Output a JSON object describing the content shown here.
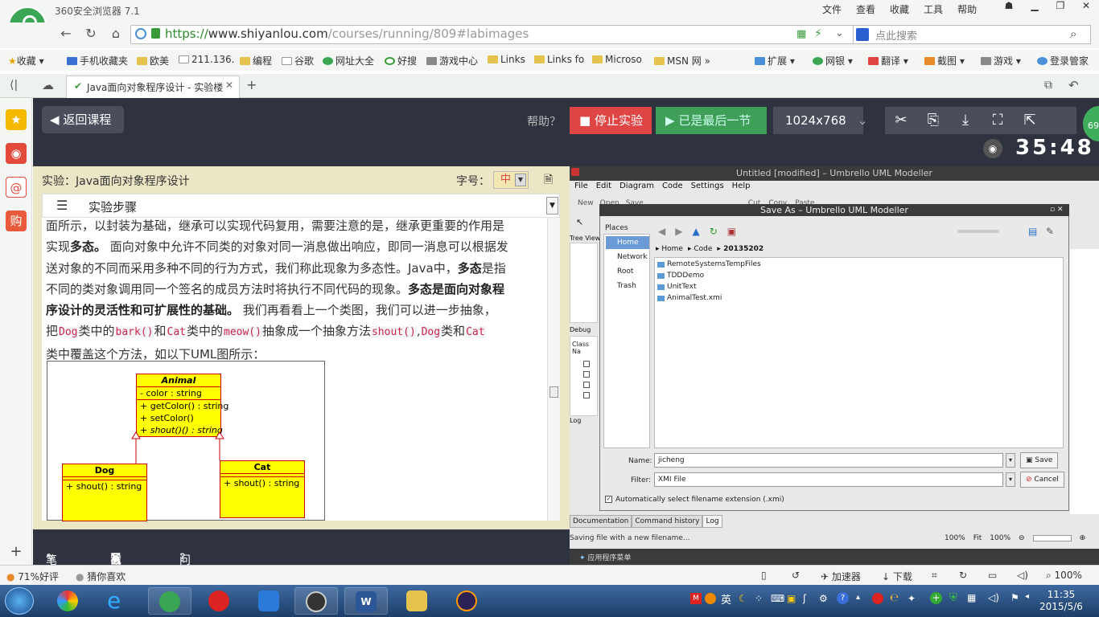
{
  "browser": {
    "app_title": "360安全浏览器 7.1",
    "menu": [
      "文件",
      "查看",
      "收藏",
      "工具",
      "帮助"
    ],
    "url_scheme": "https://",
    "url_host": "www.shiyanlou.com",
    "url_path": "/courses/running/809#labimages",
    "search_placeholder": "点此搜索",
    "bookmarks": [
      "收藏",
      "手机收藏夹",
      "欧美",
      "211.136.",
      "编程",
      "谷歌",
      "网址大全",
      "好搜",
      "游戏中心",
      "Links",
      "Links fo",
      "Microso",
      "MSN 网"
    ],
    "extensions": [
      "扩展",
      "网银",
      "翻译",
      "截图",
      "游戏",
      "登录管家"
    ],
    "tab_title": "Java面向对象程序设计 - 实验楼"
  },
  "lab": {
    "back_label": "返回课程",
    "help_label": "帮助？",
    "stop_label": "停止实验",
    "last_label": "已是最后一节",
    "resolution": "1024x768",
    "timer": "35:48",
    "badge": "69",
    "doc_title": "实验：Java面向对象程序设计",
    "font_label": "字号：",
    "font_value": "中",
    "steps_label": "实验步骤",
    "para": {
      "l1": "面所示，以封装为基础，继承可以实现代码复用，需要注意的是，继承更重要的作用是",
      "l2a": "实现",
      "l2b": "多态。",
      "l2c": " 面向对象中允许不同类的对象对同一消息做出响应，即同一消息可以根据发",
      "l3": "送对象的不同而采用多种不同的行为方式，我们称此现象为多态性。Java中，",
      "l3b": "多态",
      "l3c": "是指",
      "l4a": "不同的类对象调用同一个签名的成员方法时将执行不同代码的现象。",
      "l4b": "多态是面向对象程",
      "l5a": "序设计的灵活性和可扩展性的基础。",
      "l5b": " 我们再看看上一个类图，我们可以进一步抽象，",
      "l6a": "把",
      "c_dog": "Dog",
      "l6b": "类中的",
      "c_bark": "bark()",
      "l6c": "和",
      "c_cat": "Cat",
      "l6d": "类中的",
      "c_meow": "meow()",
      "l6e": "抽象成一个抽象方法",
      "c_shout": "shout()",
      "l6f": ",",
      "c_dog2": "Dog",
      "l6g": "类和",
      "c_cat2": "Cat",
      "l7": "类中覆盖这个方法，如以下UML图所示："
    },
    "uml": {
      "animal_name": "Animal",
      "animal_attr": "- color : string",
      "animal_ops": [
        "+ getColor() : string",
        "+ setColor()",
        "+ shout()() : string"
      ],
      "dog_name": "Dog",
      "dog_op": "+ shout() : string",
      "cat_name": "Cat",
      "cat_op": "+ shout() : string"
    },
    "bottom": [
      "笔记",
      "截图",
      "问答"
    ]
  },
  "umbrello": {
    "title": "Untitled [modified] – Umbrello UML Modeller",
    "menu": [
      "File",
      "Edit",
      "Diagram",
      "Code",
      "Settings",
      "Help"
    ],
    "toolbar": [
      "New",
      "Open",
      "Save",
      "Cut",
      "Copy",
      "Paste"
    ],
    "tree_label": "Tree View",
    "debug_label": "Debug",
    "classname_label": "Class Na",
    "log_label": "Log",
    "tabs": [
      "Documentation",
      "Command history",
      "Log"
    ],
    "status": "Saving file with a new filename...",
    "zoom": "100%",
    "fit": "Fit",
    "zoom2": "100%",
    "taskbar_label": "应用程序菜单",
    "dialog": {
      "title": "Save As – Umbrello UML Modeller",
      "places_title": "Places",
      "places": [
        "Home",
        "Network",
        "Root",
        "Trash"
      ],
      "crumbs": [
        "Home",
        "Code",
        "20135202"
      ],
      "files": [
        "RemoteSystemsTempFiles",
        "TDDDemo",
        "UnitText",
        "AnimalTest.xmi"
      ],
      "name_label": "Name:",
      "name_value": "jicheng",
      "filter_label": "Filter:",
      "filter_value": "XMI File",
      "save_label": "Save",
      "cancel_label": "Cancel",
      "checkbox_label": "Automatically select filename extension (.xmi)"
    }
  },
  "statusbar": {
    "rating": "71%好评",
    "guess": "猜你喜欢",
    "accel": "加速器",
    "download": "下载",
    "zoom": "100%"
  },
  "taskbar": {
    "time": "11:35",
    "date": "2015/5/6",
    "ime": "英"
  }
}
